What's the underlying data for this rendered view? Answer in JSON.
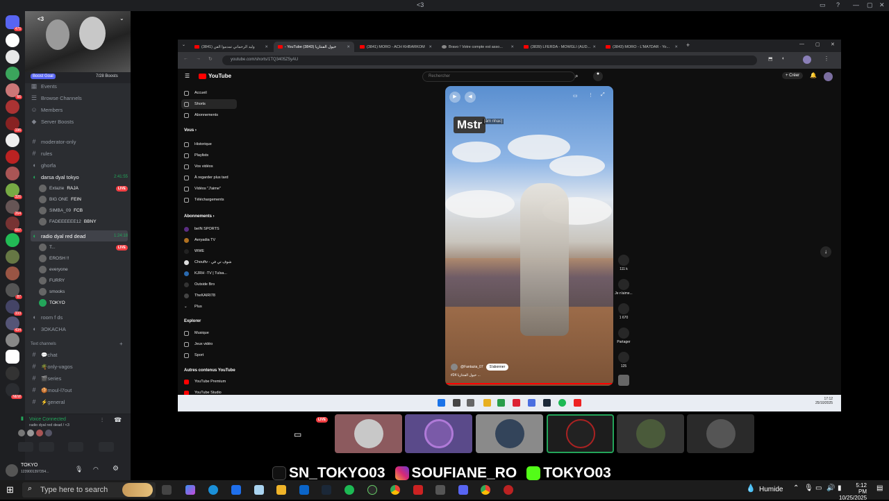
{
  "window": {
    "title": "<3"
  },
  "server": {
    "name": "<3",
    "boost_goal": "Boost Goal",
    "boost_count": "7/28 Boosts",
    "rail_badges": [
      "475",
      "66",
      "196",
      "326",
      "264",
      "667",
      "87",
      "333",
      "434",
      "NEW"
    ],
    "menu": [
      "Events",
      "Browse Channels",
      "Members",
      "Server Boosts"
    ]
  },
  "channels": {
    "text_top": [
      "moderator-only",
      "rules",
      "ghorfa"
    ],
    "voice1": {
      "name": "darsa dyal tokyo",
      "time": "2:41:55",
      "users": [
        {
          "name": "Extazie",
          "tag": "RAJA",
          "live": "LIVE"
        },
        {
          "name": "BIG ONE",
          "tag": "FEIN"
        },
        {
          "name": "SIMBA_09",
          "tag": "FCB"
        },
        {
          "name": "FADEEEEEE12",
          "tag": "BBNY"
        }
      ]
    },
    "voice2": {
      "name": "radio dyal red dead",
      "time": "1:24:18",
      "users": [
        {
          "name": "T...",
          "live": "LIVE"
        },
        {
          "name": "EROSH !!"
        },
        {
          "name": "everyone"
        },
        {
          "name": "FURRY"
        },
        {
          "name": "smooks"
        },
        {
          "name": "TOKYO"
        }
      ]
    },
    "voice_more": [
      "room f ds",
      "3OKACHA"
    ],
    "category": "Text channels",
    "text_bottom": [
      "💬chat",
      "🌴only-vagos",
      "🎬series",
      "🍪moul-l7out",
      "⚡general"
    ]
  },
  "voice": {
    "status": "Voice Connected",
    "where": "radio dyal red dead / <3"
  },
  "user": {
    "name": "TOKYO",
    "id": "1239001397354..."
  },
  "browser": {
    "tabs": [
      {
        "label": "(3841) وليد الرحماني تمدموا الفن",
        "active": false
      },
      {
        "label": "- YouTube (3843) خيول الفنتازيا",
        "active": true
      },
      {
        "label": "(3841) MORO - ACH KHBARKOM",
        "active": false
      },
      {
        "label": "Bravo ! Votre compte est asso...",
        "active": false
      },
      {
        "label": "(3839) LFERDA - MOWGLI (AUD...",
        "active": false
      },
      {
        "label": "(3843) MORO - L'MA7DAR - Yo...",
        "active": false
      }
    ],
    "new_tab": "+",
    "url": "youtube.com/shorts/1TQ3405Z5yAU"
  },
  "youtube": {
    "logo": "YouTube",
    "search_placeholder": "Rechercher",
    "create": "Créer",
    "nav": [
      "Accueil",
      "Shorts",
      "Abonnements"
    ],
    "you_header": "Vous",
    "you_items": [
      "Historique",
      "Playlists",
      "Vos vidéos",
      "À regarder plus tard",
      "Vidéos \"J'aime\"",
      "Téléchargements"
    ],
    "subs_header": "Abonnements",
    "subs": [
      "beIN SPORTS",
      "Aeryadia TV",
      "WWE",
      "Chouftv - شوف تي في",
      "KJRH -TV | Tulsa...",
      "Outside Bro",
      "TheKAIRI78"
    ],
    "more": "Plus",
    "explore_header": "Explorer",
    "explore": [
      "Musique",
      "Jeux vidéo",
      "Sport"
    ],
    "other_header": "Autres contenus YouTube",
    "other": [
      "YouTube Premium",
      "YouTube Studio"
    ],
    "short": {
      "overlay": "Mstr",
      "overlay_tag": "[âm nhạc]",
      "channel": "@Fantazia_07",
      "subscribe": "S'abonner",
      "caption": "#24 خيول الفنتازيا ..."
    },
    "actions": [
      {
        "icon": "like-icon",
        "label": "111 k"
      },
      {
        "icon": "dislike-icon",
        "label": "Je n'aime..."
      },
      {
        "icon": "comment-icon",
        "label": "1 670"
      },
      {
        "icon": "share-icon",
        "label": "Partager"
      },
      {
        "icon": "remix-icon",
        "label": "125"
      }
    ]
  },
  "inner_clock": {
    "time": "17:12",
    "date": "25/10/2025"
  },
  "stream": {
    "live": "LIVE"
  },
  "socials": [
    "SN_TOKYO03",
    "SOUFIANE_RO",
    "TOKYO03"
  ],
  "taskbar": {
    "search": "Type here to search",
    "weather": "Humide",
    "time": "5:12 PM",
    "date": "10/25/2025"
  },
  "colors": {
    "discord_green": "#23a55a",
    "live_red": "#f23f43",
    "youtube_red": "#ff0000"
  }
}
